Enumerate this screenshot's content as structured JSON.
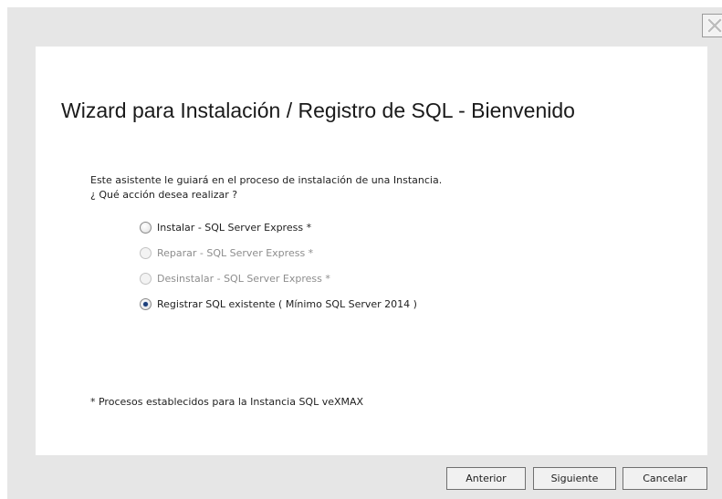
{
  "window": {
    "close_glyph": "X",
    "close_icon": "close-icon"
  },
  "wizard": {
    "title": "Wizard para Instalación / Registro de SQL - Bienvenido",
    "intro_line1": "Este asistente le guiará en el proceso de instalación de una Instancia.",
    "intro_line2": "¿ Qué acción desea realizar ?",
    "options": [
      {
        "label": "Instalar - SQL Server Express *",
        "enabled": true,
        "selected": false
      },
      {
        "label": "Reparar - SQL Server Express *",
        "enabled": false,
        "selected": false
      },
      {
        "label": "Desinstalar - SQL Server Express *",
        "enabled": false,
        "selected": false
      },
      {
        "label": "Registrar SQL existente ( Mínimo SQL Server 2014 )",
        "enabled": true,
        "selected": true
      }
    ],
    "footnote": "* Procesos establecidos para la Instancia SQL veXMAX"
  },
  "buttons": {
    "back_label": "Anterior",
    "next_label": "Siguiente",
    "cancel_label": "Cancelar"
  },
  "colors": {
    "window_background": "#e6e6e6",
    "panel_background": "#ffffff",
    "radio_selected": "#1d3f7a",
    "disabled_text": "#8d8d8d"
  }
}
